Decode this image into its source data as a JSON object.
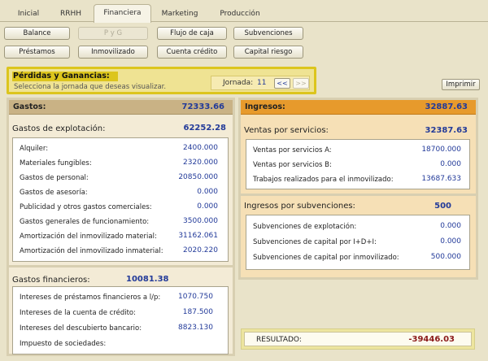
{
  "tabs": [
    "Inicial",
    "RRHH",
    "Financiera",
    "Marketing",
    "Producción"
  ],
  "buttons_row1": [
    "Balance",
    "P y G",
    "Flujo de caja",
    "Subvenciones"
  ],
  "buttons_row2": [
    "Préstamos",
    "Inmovilizado",
    "Cuenta crédito",
    "Capital riesgo"
  ],
  "header": {
    "title": "Pérdidas y Ganancias:",
    "subtitle": "Selecciona la jornada que deseas visualizar.",
    "jornada_label": "Jornada:",
    "jornada_value": "11",
    "prev": "<<",
    "next": ">>"
  },
  "print_label": "Imprimir",
  "gastos": {
    "label": "Gastos:",
    "total": "72333.66",
    "explotacion": {
      "label": "Gastos de explotación:",
      "total": "62252.28",
      "items": [
        {
          "label": "Alquiler:",
          "value": "2400.000"
        },
        {
          "label": "Materiales fungibles:",
          "value": "2320.000"
        },
        {
          "label": "Gastos de personal:",
          "value": "20850.000"
        },
        {
          "label": "Gastos de asesoría:",
          "value": "0.000"
        },
        {
          "label": "Publicidad y otros gastos comerciales:",
          "value": "0.000"
        },
        {
          "label": "Gastos generales de funcionamiento:",
          "value": "3500.000"
        },
        {
          "label": "Amortización del inmovilizado material:",
          "value": "31162.061"
        },
        {
          "label": "Amortización del inmovilizado inmaterial:",
          "value": "2020.220"
        }
      ]
    },
    "financieros": {
      "label": "Gastos financieros:",
      "total": "10081.38",
      "items": [
        {
          "label": "Intereses de préstamos financieros a l/p:",
          "value": "1070.750"
        },
        {
          "label": "Intereses de la cuenta de crédito:",
          "value": "187.500"
        },
        {
          "label": "Intereses del descubierto bancario:",
          "value": "8823.130"
        },
        {
          "label": "Impuesto de sociedades:",
          "value": "0.000"
        }
      ]
    }
  },
  "ingresos": {
    "label": "Ingresos:",
    "total": "32887.63",
    "ventas": {
      "label": "Ventas por servicios:",
      "total": "32387.63",
      "items": [
        {
          "label": "Ventas por servicios A:",
          "value": "18700.000"
        },
        {
          "label": "Ventas por servicios B:",
          "value": "0.000"
        },
        {
          "label": "Trabajos realizados para el inmovilizado:",
          "value": "13687.633"
        }
      ]
    },
    "subvenciones": {
      "label": "Ingresos por subvenciones:",
      "total": "500",
      "items": [
        {
          "label": "Subvenciones de explotación:",
          "value": "0.000"
        },
        {
          "label": "Subvenciones de capital por I+D+I:",
          "value": "0.000"
        },
        {
          "label": "Subvenciones de capital por inmovilizado:",
          "value": "500.000"
        }
      ]
    }
  },
  "resultado": {
    "label": "RESULTADO:",
    "value": "-39446.03"
  },
  "colors": {
    "accent_blue": "#223a99",
    "negative": "#8b1a1a",
    "gold": "#dcc51d",
    "ingresos_header": "#e79a2c"
  }
}
